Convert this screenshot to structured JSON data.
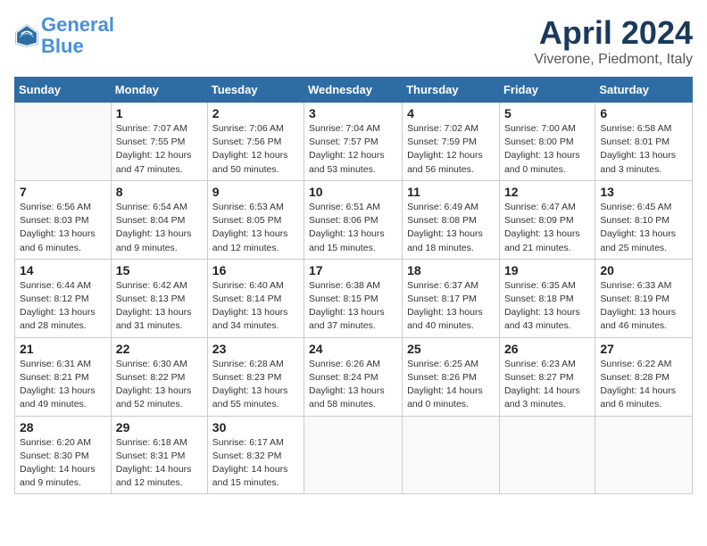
{
  "logo": {
    "line1": "General",
    "line2": "Blue"
  },
  "title": "April 2024",
  "subtitle": "Viverone, Piedmont, Italy",
  "days_header": [
    "Sunday",
    "Monday",
    "Tuesday",
    "Wednesday",
    "Thursday",
    "Friday",
    "Saturday"
  ],
  "weeks": [
    [
      {
        "day": "",
        "info": ""
      },
      {
        "day": "1",
        "info": "Sunrise: 7:07 AM\nSunset: 7:55 PM\nDaylight: 12 hours\nand 47 minutes."
      },
      {
        "day": "2",
        "info": "Sunrise: 7:06 AM\nSunset: 7:56 PM\nDaylight: 12 hours\nand 50 minutes."
      },
      {
        "day": "3",
        "info": "Sunrise: 7:04 AM\nSunset: 7:57 PM\nDaylight: 12 hours\nand 53 minutes."
      },
      {
        "day": "4",
        "info": "Sunrise: 7:02 AM\nSunset: 7:59 PM\nDaylight: 12 hours\nand 56 minutes."
      },
      {
        "day": "5",
        "info": "Sunrise: 7:00 AM\nSunset: 8:00 PM\nDaylight: 13 hours\nand 0 minutes."
      },
      {
        "day": "6",
        "info": "Sunrise: 6:58 AM\nSunset: 8:01 PM\nDaylight: 13 hours\nand 3 minutes."
      }
    ],
    [
      {
        "day": "7",
        "info": "Sunrise: 6:56 AM\nSunset: 8:03 PM\nDaylight: 13 hours\nand 6 minutes."
      },
      {
        "day": "8",
        "info": "Sunrise: 6:54 AM\nSunset: 8:04 PM\nDaylight: 13 hours\nand 9 minutes."
      },
      {
        "day": "9",
        "info": "Sunrise: 6:53 AM\nSunset: 8:05 PM\nDaylight: 13 hours\nand 12 minutes."
      },
      {
        "day": "10",
        "info": "Sunrise: 6:51 AM\nSunset: 8:06 PM\nDaylight: 13 hours\nand 15 minutes."
      },
      {
        "day": "11",
        "info": "Sunrise: 6:49 AM\nSunset: 8:08 PM\nDaylight: 13 hours\nand 18 minutes."
      },
      {
        "day": "12",
        "info": "Sunrise: 6:47 AM\nSunset: 8:09 PM\nDaylight: 13 hours\nand 21 minutes."
      },
      {
        "day": "13",
        "info": "Sunrise: 6:45 AM\nSunset: 8:10 PM\nDaylight: 13 hours\nand 25 minutes."
      }
    ],
    [
      {
        "day": "14",
        "info": "Sunrise: 6:44 AM\nSunset: 8:12 PM\nDaylight: 13 hours\nand 28 minutes."
      },
      {
        "day": "15",
        "info": "Sunrise: 6:42 AM\nSunset: 8:13 PM\nDaylight: 13 hours\nand 31 minutes."
      },
      {
        "day": "16",
        "info": "Sunrise: 6:40 AM\nSunset: 8:14 PM\nDaylight: 13 hours\nand 34 minutes."
      },
      {
        "day": "17",
        "info": "Sunrise: 6:38 AM\nSunset: 8:15 PM\nDaylight: 13 hours\nand 37 minutes."
      },
      {
        "day": "18",
        "info": "Sunrise: 6:37 AM\nSunset: 8:17 PM\nDaylight: 13 hours\nand 40 minutes."
      },
      {
        "day": "19",
        "info": "Sunrise: 6:35 AM\nSunset: 8:18 PM\nDaylight: 13 hours\nand 43 minutes."
      },
      {
        "day": "20",
        "info": "Sunrise: 6:33 AM\nSunset: 8:19 PM\nDaylight: 13 hours\nand 46 minutes."
      }
    ],
    [
      {
        "day": "21",
        "info": "Sunrise: 6:31 AM\nSunset: 8:21 PM\nDaylight: 13 hours\nand 49 minutes."
      },
      {
        "day": "22",
        "info": "Sunrise: 6:30 AM\nSunset: 8:22 PM\nDaylight: 13 hours\nand 52 minutes."
      },
      {
        "day": "23",
        "info": "Sunrise: 6:28 AM\nSunset: 8:23 PM\nDaylight: 13 hours\nand 55 minutes."
      },
      {
        "day": "24",
        "info": "Sunrise: 6:26 AM\nSunset: 8:24 PM\nDaylight: 13 hours\nand 58 minutes."
      },
      {
        "day": "25",
        "info": "Sunrise: 6:25 AM\nSunset: 8:26 PM\nDaylight: 14 hours\nand 0 minutes."
      },
      {
        "day": "26",
        "info": "Sunrise: 6:23 AM\nSunset: 8:27 PM\nDaylight: 14 hours\nand 3 minutes."
      },
      {
        "day": "27",
        "info": "Sunrise: 6:22 AM\nSunset: 8:28 PM\nDaylight: 14 hours\nand 6 minutes."
      }
    ],
    [
      {
        "day": "28",
        "info": "Sunrise: 6:20 AM\nSunset: 8:30 PM\nDaylight: 14 hours\nand 9 minutes."
      },
      {
        "day": "29",
        "info": "Sunrise: 6:18 AM\nSunset: 8:31 PM\nDaylight: 14 hours\nand 12 minutes."
      },
      {
        "day": "30",
        "info": "Sunrise: 6:17 AM\nSunset: 8:32 PM\nDaylight: 14 hours\nand 15 minutes."
      },
      {
        "day": "",
        "info": ""
      },
      {
        "day": "",
        "info": ""
      },
      {
        "day": "",
        "info": ""
      },
      {
        "day": "",
        "info": ""
      }
    ]
  ]
}
